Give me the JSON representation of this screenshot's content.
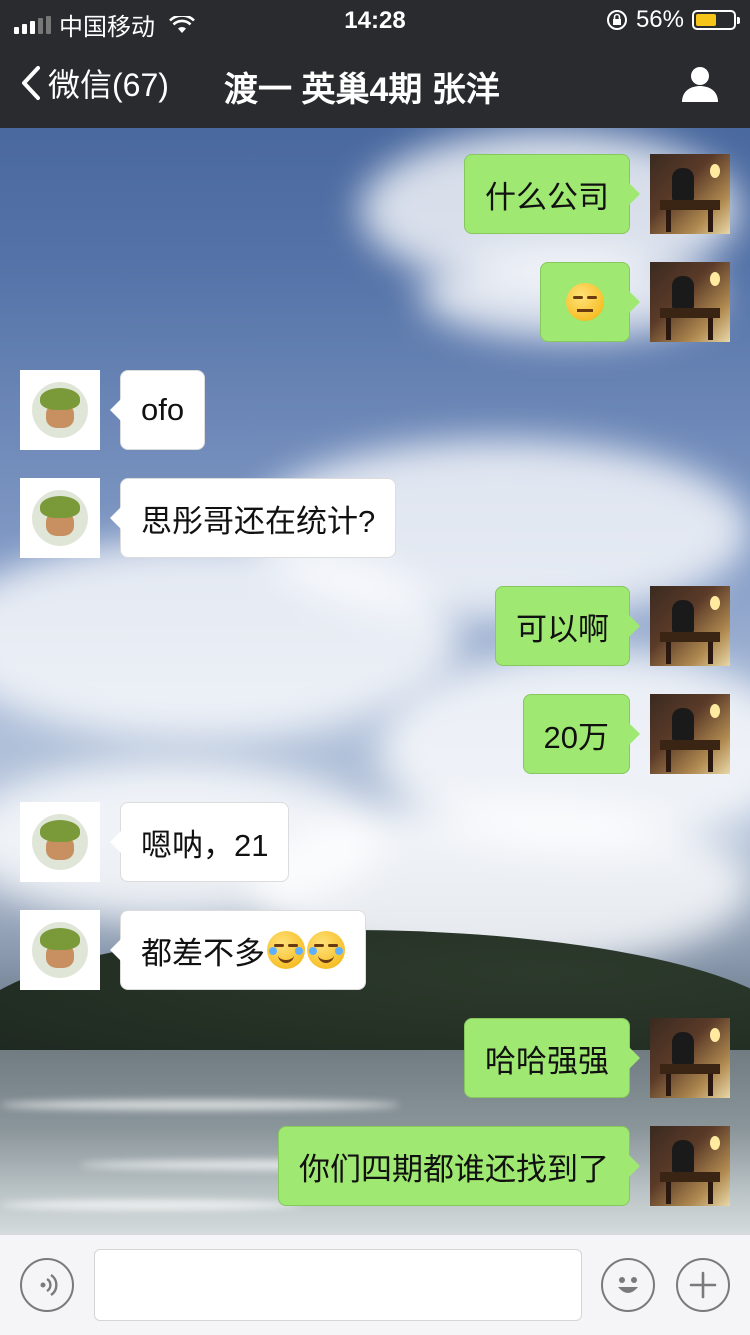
{
  "status_bar": {
    "carrier": "中国移动",
    "time": "14:28",
    "battery_percent": "56%",
    "battery_level": 0.56,
    "signal_bars": 3,
    "signal_bars_total": 5,
    "icons": [
      "signal-icon",
      "wifi-icon",
      "rotation-lock-icon",
      "battery-icon"
    ]
  },
  "nav": {
    "back_label": "微信(67)",
    "title": "渡一 英巢4期 张洋",
    "icons": [
      "back-chevron-icon",
      "profile-icon"
    ]
  },
  "messages": [
    {
      "side": "out",
      "text": "什么公司"
    },
    {
      "side": "out",
      "text": "",
      "emoji": "thinking-face"
    },
    {
      "side": "in",
      "text": "ofo"
    },
    {
      "side": "in",
      "text": "思彤哥还在统计?"
    },
    {
      "side": "out",
      "text": "可以啊"
    },
    {
      "side": "out",
      "text": "20万"
    },
    {
      "side": "in",
      "text": "嗯呐，21"
    },
    {
      "side": "in",
      "text": "都差不多",
      "emoji": "laughing-tears x2"
    },
    {
      "side": "out",
      "text": "哈哈强强"
    },
    {
      "side": "out",
      "text": "你们四期都谁还找到了"
    }
  ],
  "input_bar": {
    "input_value": "",
    "icons": [
      "voice-icon",
      "emoji-icon",
      "plus-icon"
    ]
  },
  "colors": {
    "bar_bg": "#2a2b2f",
    "bubble_out": "#9fe871",
    "bubble_in": "#ffffff",
    "battery": "#f5c518"
  }
}
